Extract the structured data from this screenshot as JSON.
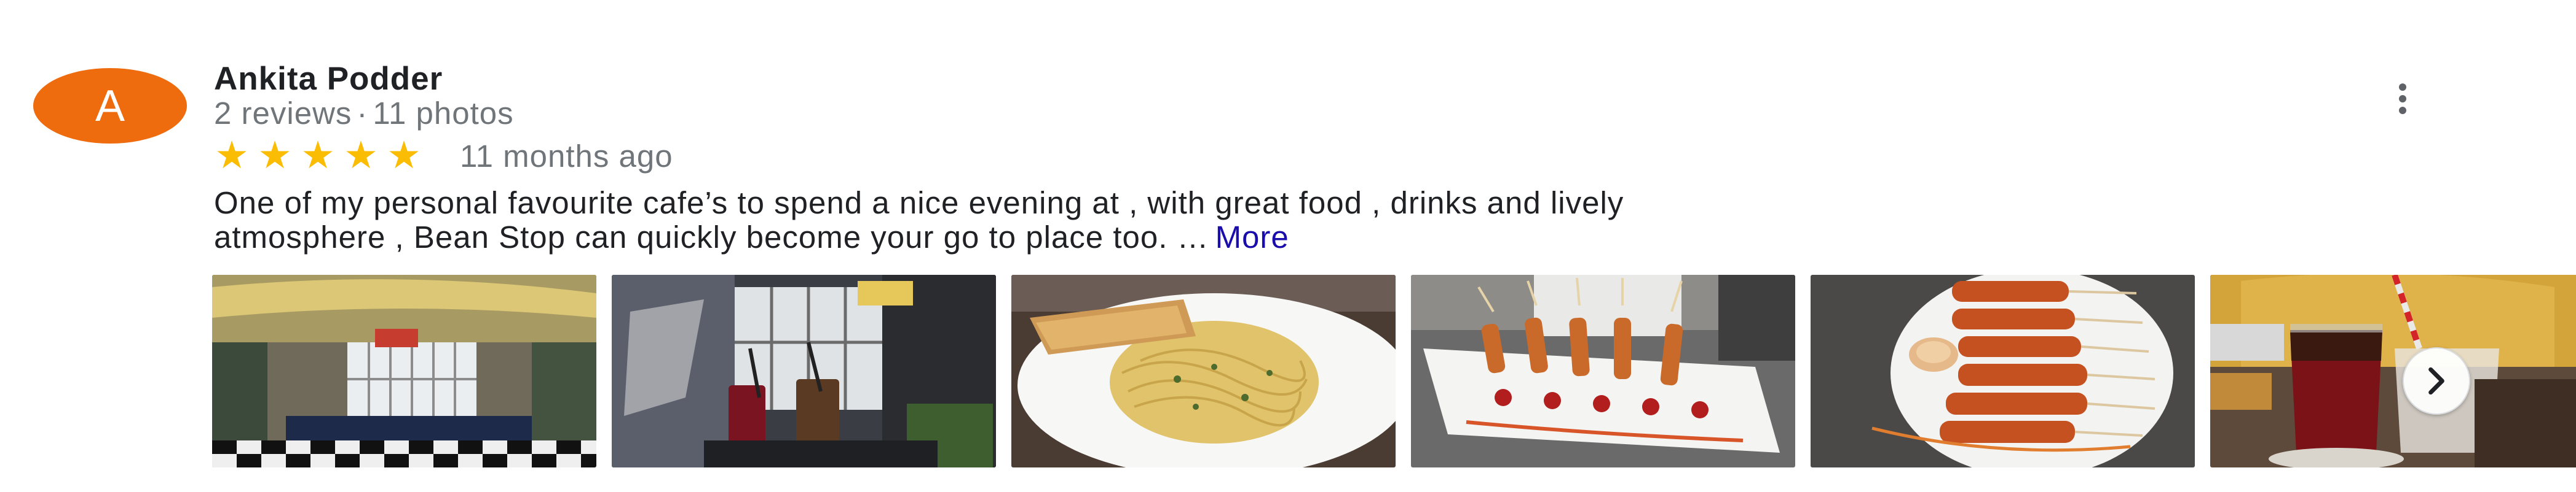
{
  "review": {
    "avatar_letter": "A",
    "avatar_color": "#ee6c0e",
    "author_name": "Ankita Podder",
    "reviews_count": "2 reviews",
    "separator": "·",
    "photos_count": "11 photos",
    "rating": 5,
    "rating_max": 5,
    "star_char": "★",
    "star_color": "#fbbc04",
    "time_ago": "11 months ago",
    "text_line1": "One of my personal favourite cafe’s to spend a nice evening at , with great food , drinks and lively",
    "text_line2": "atmosphere , Bean Stop can quickly become your go to place too. …",
    "more_label": "More",
    "more_link_color": "#1a0dab"
  },
  "photos": [
    {
      "subject": "cafe-interior"
    },
    {
      "subject": "cafe-drinks-outdoor"
    },
    {
      "subject": "pasta-plate"
    },
    {
      "subject": "skewers-platter"
    },
    {
      "subject": "grilled-skewers"
    },
    {
      "subject": "iced-drink"
    }
  ],
  "icons": {
    "overflow_menu": "more-vert-icon",
    "next": "chevron-right-icon"
  }
}
